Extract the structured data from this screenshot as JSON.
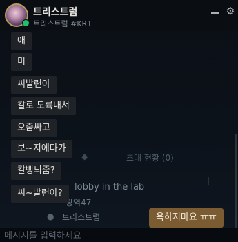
{
  "header": {
    "name": "트리스트럼",
    "subname": "트리스트럼 #KR1",
    "minimize_icon": "minimize-icon",
    "settings_icon": "gear-icon",
    "status_color": "#1fbf6b"
  },
  "background": {
    "event_label": "초대 현황 (0)",
    "lobby_label": "lobby in the lab",
    "tag_label": "광역47",
    "member_label": "트리스트럼"
  },
  "messages": [
    {
      "text": "애"
    },
    {
      "text": "미"
    },
    {
      "text": "씨발련아"
    },
    {
      "text": "칼로 도륙내서"
    },
    {
      "text": "오줌싸고"
    },
    {
      "text": "보~지에다가"
    },
    {
      "text": "칼빵뇌줌?"
    },
    {
      "text": "씨~발련아?"
    }
  ],
  "outgoing": {
    "text": "욕하지마요 ㅠㅠ"
  },
  "input": {
    "placeholder": "메시지를 입력하세요"
  },
  "colors": {
    "incoming_bubble": "#1f2328",
    "outgoing_bubble": "#7a5b32",
    "accent_gold": "#b89b5e"
  }
}
